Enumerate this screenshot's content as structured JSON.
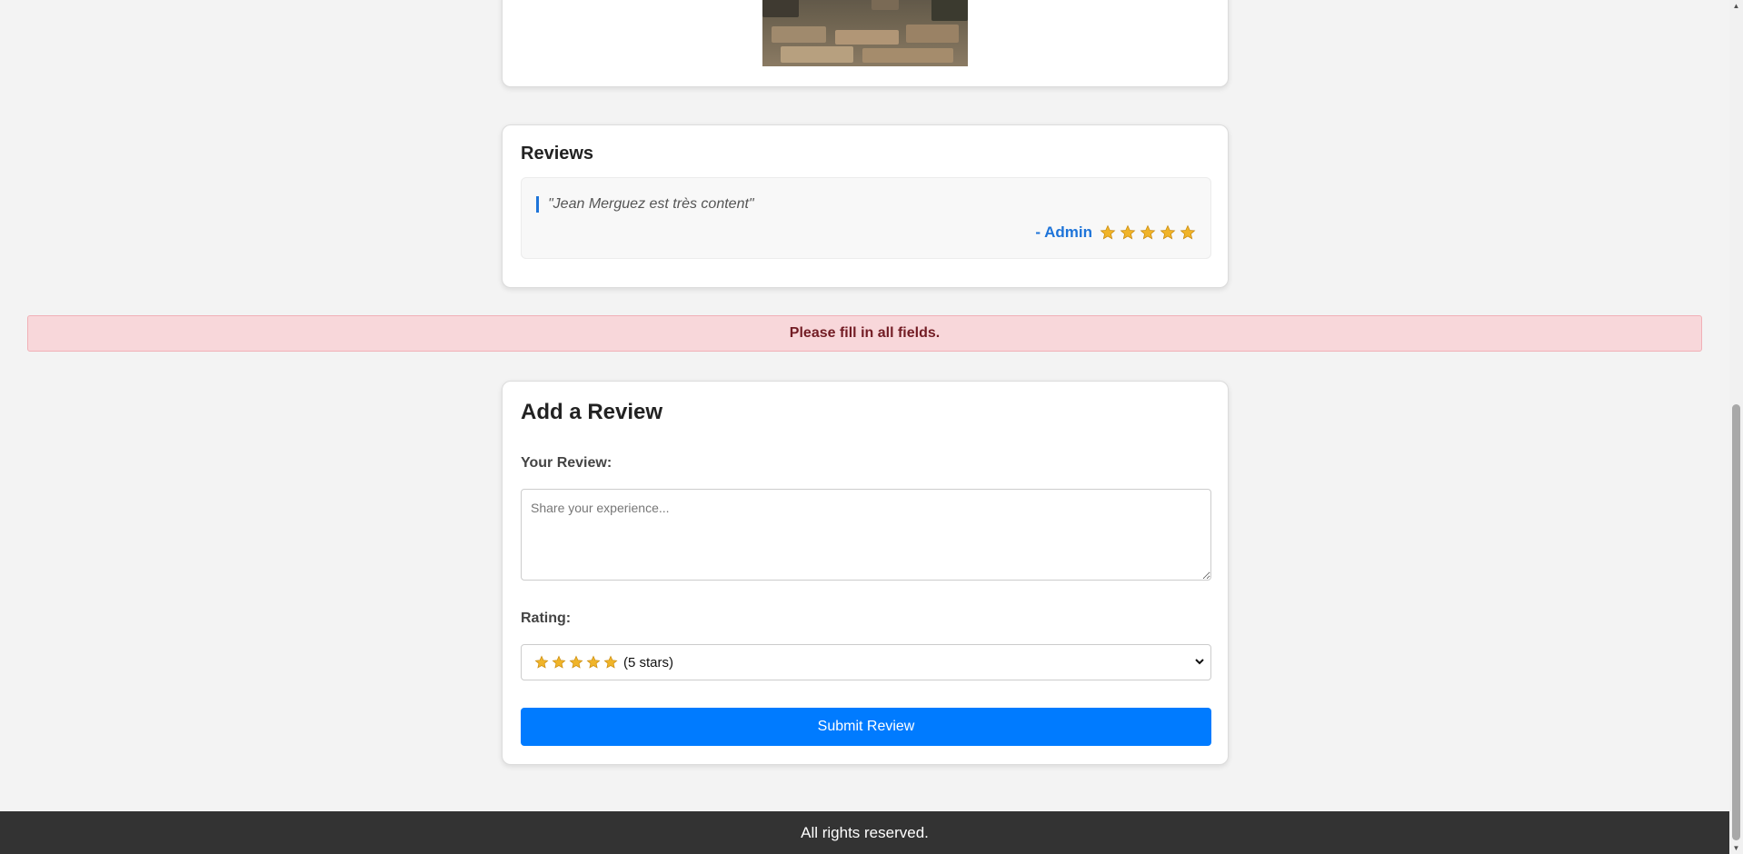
{
  "reviews": {
    "title": "Reviews",
    "items": [
      {
        "text": "\"Jean Merguez est très content\"",
        "author": "- Admin",
        "rating": 5
      }
    ]
  },
  "alert": {
    "message": "Please fill in all fields."
  },
  "add_review": {
    "title": "Add a Review",
    "review_label": "Your Review:",
    "review_placeholder": "Share your experience...",
    "review_value": "",
    "rating_label": "Rating:",
    "rating_selected": {
      "stars": 5,
      "text": "(5 stars)"
    },
    "submit_label": "Submit Review"
  },
  "footer": {
    "text": "All rights reserved."
  },
  "colors": {
    "accent": "#007bff",
    "author": "#1e74d9",
    "alert_bg": "#f8d7da",
    "alert_text": "#721c24",
    "star": "#f0b429",
    "footer_bg": "#333333"
  },
  "icons": {
    "star": "star-icon",
    "chevron": "chevron-down-icon"
  }
}
